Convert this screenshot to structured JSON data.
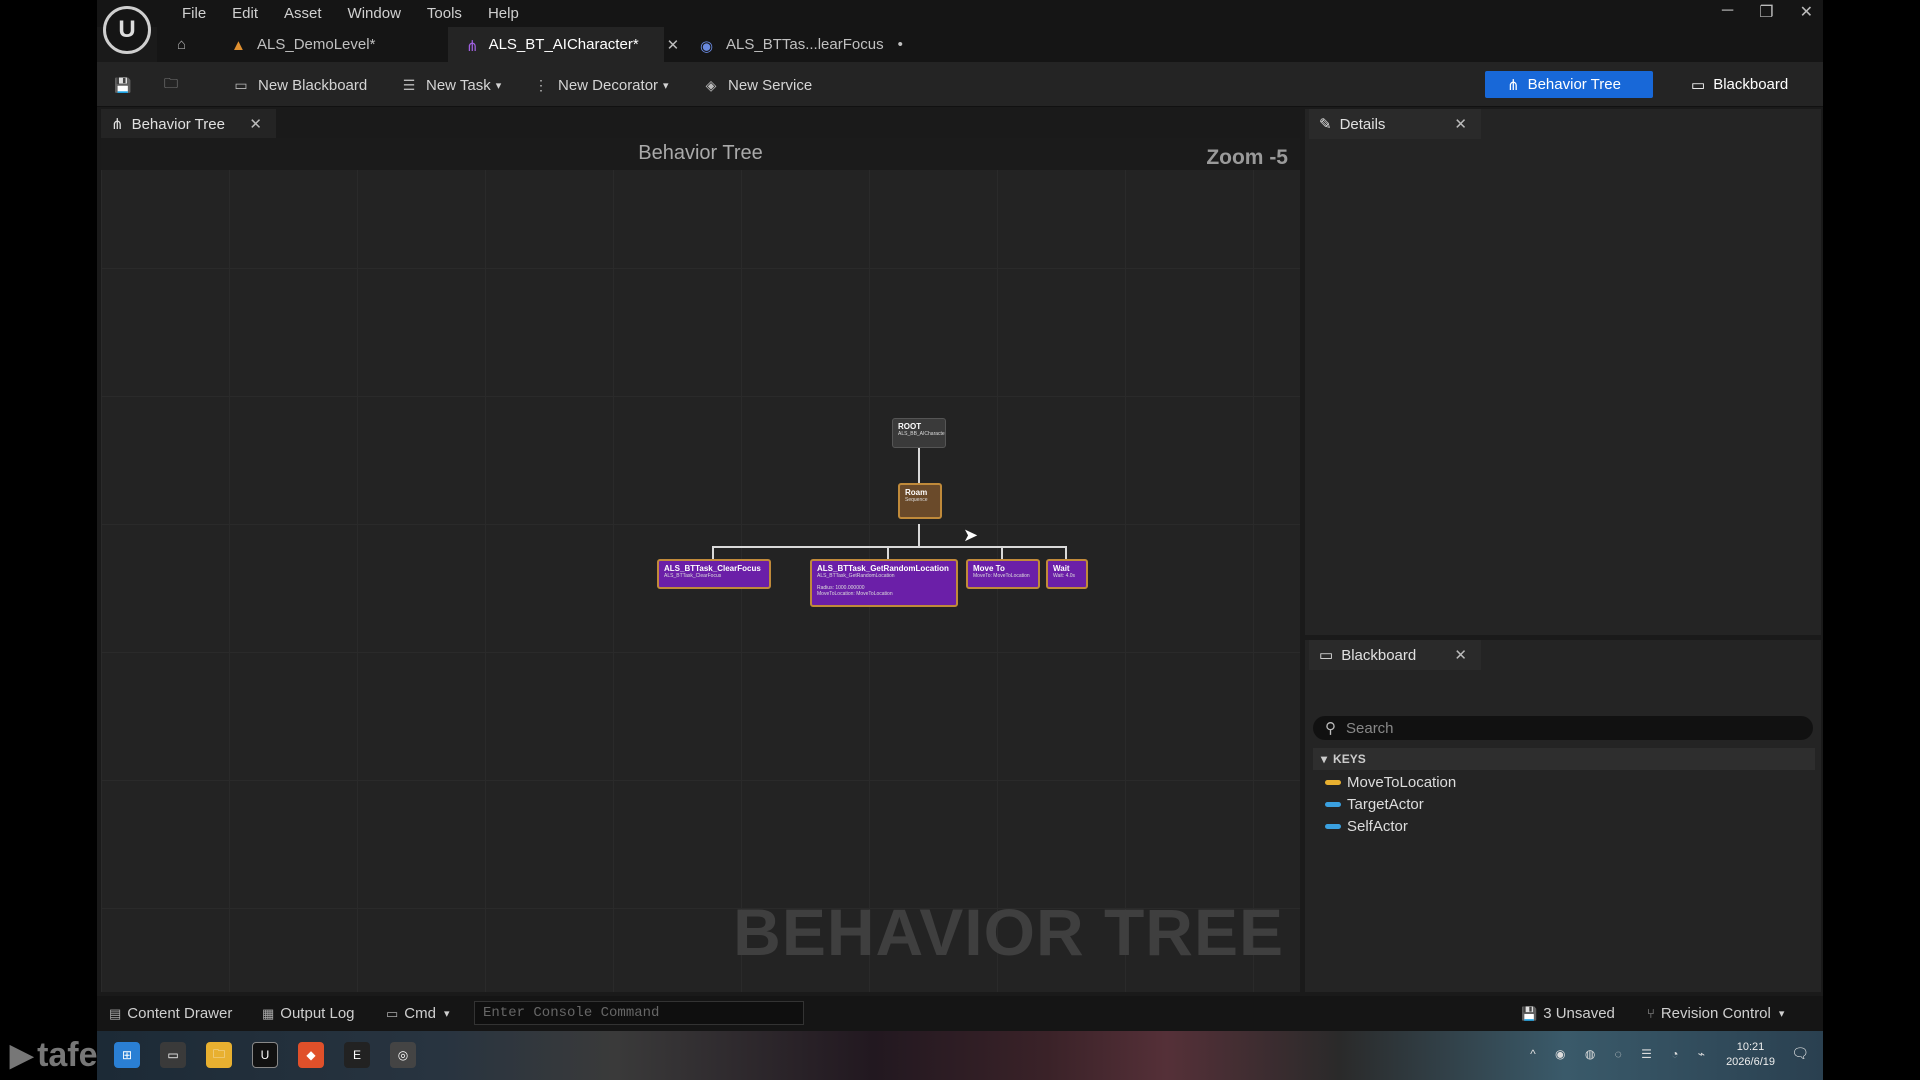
{
  "menu": [
    "File",
    "Edit",
    "Asset",
    "Window",
    "Tools",
    "Help"
  ],
  "tabs": [
    {
      "label": "ALS_DemoLevel*"
    },
    {
      "label": "ALS_BT_AICharacter*"
    },
    {
      "label": "ALS_BTTas...learFocus",
      "modified": "•"
    }
  ],
  "toolbar": {
    "new_blackboard": "New Blackboard",
    "new_task": "New Task",
    "new_decorator": "New Decorator",
    "new_service": "New Service",
    "mode_behavior_tree": "Behavior Tree",
    "mode_blackboard": "Blackboard"
  },
  "graph_panel": {
    "tab_label": "Behavior Tree",
    "title": "Behavior Tree",
    "zoom": "Zoom -5",
    "watermark": "BEHAVIOR TREE"
  },
  "nodes": {
    "root": {
      "label": "ROOT",
      "sub": "ALS_BB_AICharacter"
    },
    "roam": {
      "label": "Roam",
      "sub": "Sequence"
    },
    "clear_focus": {
      "label": "ALS_BTTask_ClearFocus",
      "sub": "ALS_BTTask_ClearFocus"
    },
    "get_random": {
      "label": "ALS_BTTask_GetRandomLocation",
      "sub": "ALS_BTTask_GetRandomLocation",
      "detail1": "Radius: 1000.000000",
      "detail2": "MoveToLocation: MoveToLocation"
    },
    "move_to": {
      "label": "Move To",
      "sub": "MoveTo: MoveToLocation"
    },
    "wait": {
      "label": "Wait",
      "sub": "Wait: 4.0s"
    }
  },
  "details_panel": {
    "tab_label": "Details"
  },
  "blackboard_panel": {
    "tab_label": "Blackboard",
    "search_placeholder": "Search",
    "keys_header": "KEYS",
    "keys": [
      {
        "name": "MoveToLocation",
        "color": "#e8b030"
      },
      {
        "name": "TargetActor",
        "color": "#3aa0e0"
      },
      {
        "name": "SelfActor",
        "color": "#3aa0e0"
      }
    ]
  },
  "statusbar": {
    "content_drawer": "Content Drawer",
    "output_log": "Output Log",
    "cmd": "Cmd",
    "console_placeholder": "Enter Console Command",
    "unsaved": "3 Unsaved",
    "revision_control": "Revision Control"
  },
  "taskbar": {
    "time": "10:21",
    "date": "2026/6/19",
    "watermark": "tafe"
  },
  "colors": {
    "accent": "#1868d8",
    "task_node": "#6b1fa8"
  }
}
